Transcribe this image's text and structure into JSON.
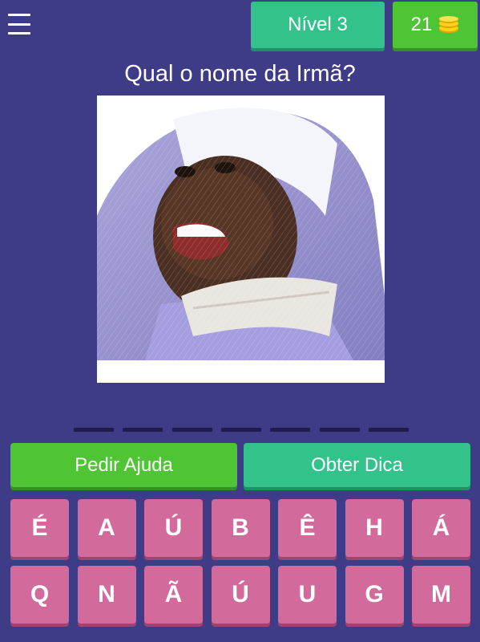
{
  "header": {
    "menu_icon": "hamburger-menu-icon",
    "level_label": "Nível 3",
    "coins": "21",
    "coin_icon": "coin-stack-icon"
  },
  "question": "Qual o nome da Irmã?",
  "answer_slots": 7,
  "buttons": {
    "help": "Pedir Ajuda",
    "hint": "Obter Dica"
  },
  "letters": {
    "row1": [
      "É",
      "A",
      "Ú",
      "B",
      "Ê",
      "H",
      "Á"
    ],
    "row2": [
      "Q",
      "N",
      "Ã",
      "Ú",
      "U",
      "G",
      "M"
    ]
  },
  "colors": {
    "background": "#3e3b87",
    "level": "#33c38a",
    "coins": "#4fc434",
    "key": "#d26b9b"
  }
}
